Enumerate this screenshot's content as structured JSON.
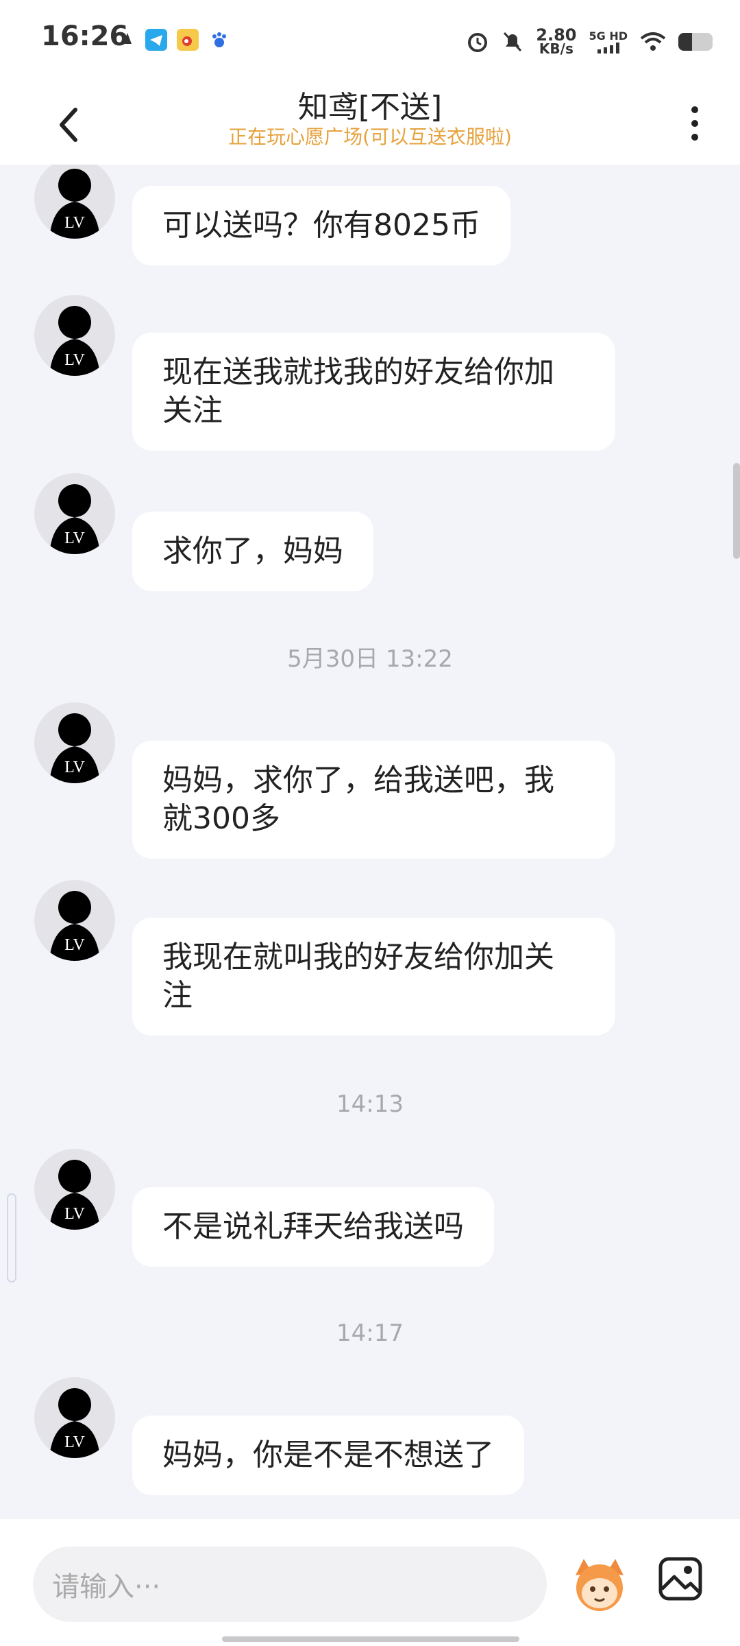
{
  "status_bar": {
    "time": "16:26",
    "net_speed_value": "2.80",
    "net_speed_unit": "KB/s",
    "network": "5G HD"
  },
  "header": {
    "title": "知鸢[不送]",
    "subtitle": "正在玩心愿广场(可以互送衣服啦)"
  },
  "messages": [
    {
      "text": "可以送吗？你有8025币"
    },
    {
      "text": "现在送我就找我的好友给你加\n关注"
    },
    {
      "text": "求你了，妈妈"
    },
    {
      "text": "妈妈，求你了，给我送吧，我\n就300多"
    },
    {
      "text": "我现在就叫我的好友给你加关\n注"
    },
    {
      "text": "不是说礼拜天给我送吗"
    },
    {
      "text": "妈妈，你是不是不想送了"
    }
  ],
  "timestamps": [
    "5月30日 13:22",
    "14:13",
    "14:17"
  ],
  "input": {
    "placeholder": "请输入···"
  },
  "icons": {
    "back": "chevron-left-icon",
    "more": "more-vertical-icon",
    "mascot": "mascot-emoji-icon",
    "gallery": "image-gallery-icon"
  },
  "colors": {
    "accent": "#e6a23c",
    "chat_bg": "#f3f4fa",
    "bubble": "#ffffff"
  }
}
